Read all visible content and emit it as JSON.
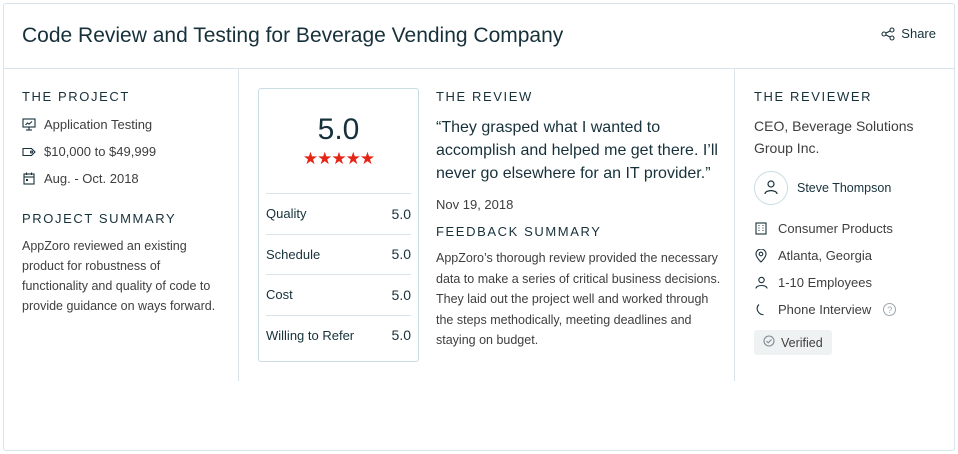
{
  "header": {
    "title": "Code Review and Testing for Beverage Vending Company",
    "share_label": "Share"
  },
  "project": {
    "section_label": "THE PROJECT",
    "service": "Application Testing",
    "budget": "$10,000 to $49,999",
    "dates": "Aug. - Oct. 2018",
    "summary_label": "PROJECT SUMMARY",
    "summary": "AppZoro reviewed an existing product for robustness of functionality and quality of code to provide guidance on ways forward."
  },
  "rating": {
    "overall": "5.0",
    "stars": "★★★★★",
    "star_color": "#e62415",
    "scores": [
      {
        "label": "Quality",
        "value": "5.0"
      },
      {
        "label": "Schedule",
        "value": "5.0"
      },
      {
        "label": "Cost",
        "value": "5.0"
      },
      {
        "label": "Willing to Refer",
        "value": "5.0"
      }
    ]
  },
  "review": {
    "section_label": "THE REVIEW",
    "quote": "“They grasped what I wanted to accomplish and helped me get there. I’ll never go elsewhere for an IT provider.”",
    "date": "Nov 19, 2018",
    "feedback_label": "FEEDBACK SUMMARY",
    "feedback": "AppZoro’s thorough review provided the necessary data to make a series of critical business decisions. They laid out the project well and worked through the steps methodically, meeting deadlines and staying on budget."
  },
  "reviewer": {
    "section_label": "THE REVIEWER",
    "title": "CEO, Beverage Solutions Group Inc.",
    "name": "Steve Thompson",
    "industry": "Consumer Products",
    "location": "Atlanta, Georgia",
    "company_size": "1-10 Employees",
    "interview_type": "Phone Interview",
    "help_glyph": "?",
    "verified_label": "Verified"
  }
}
